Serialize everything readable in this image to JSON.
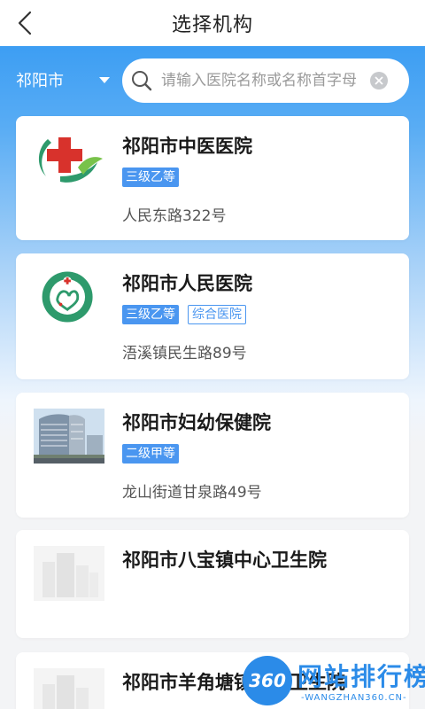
{
  "header": {
    "title": "选择机构"
  },
  "filter": {
    "city": "祁阳市",
    "search_placeholder": "请输入医院名称或名称首字母"
  },
  "hospitals": [
    {
      "name": "祁阳市中医医院",
      "tags": [
        "三级乙等"
      ],
      "address": "人民东路322号",
      "logo": "cross-leaf-logo"
    },
    {
      "name": "祁阳市人民医院",
      "tags": [
        "三级乙等"
      ],
      "type_tag": "综合医院",
      "address": "浯溪镇民生路89号",
      "logo": "circular-emblem-logo"
    },
    {
      "name": "祁阳市妇幼保健院",
      "tags": [
        "二级甲等"
      ],
      "address": "龙山街道甘泉路49号",
      "logo": "building-photo"
    },
    {
      "name": "祁阳市八宝镇中心卫生院",
      "tags": [],
      "address": "",
      "logo": "placeholder-building-icon"
    },
    {
      "name": "祁阳市羊角塘镇中心卫生院",
      "tags": [],
      "address": "",
      "logo": "placeholder-building-icon"
    }
  ],
  "watermark": {
    "badge": "360",
    "text": "网站排行榜",
    "sub": "-WANGZHAN360.CN-"
  },
  "colors": {
    "accent": "#4a96f0",
    "header_blue": "#3d9ef3",
    "logo_red": "#d8322c",
    "logo_green": "#2e9a6c"
  }
}
